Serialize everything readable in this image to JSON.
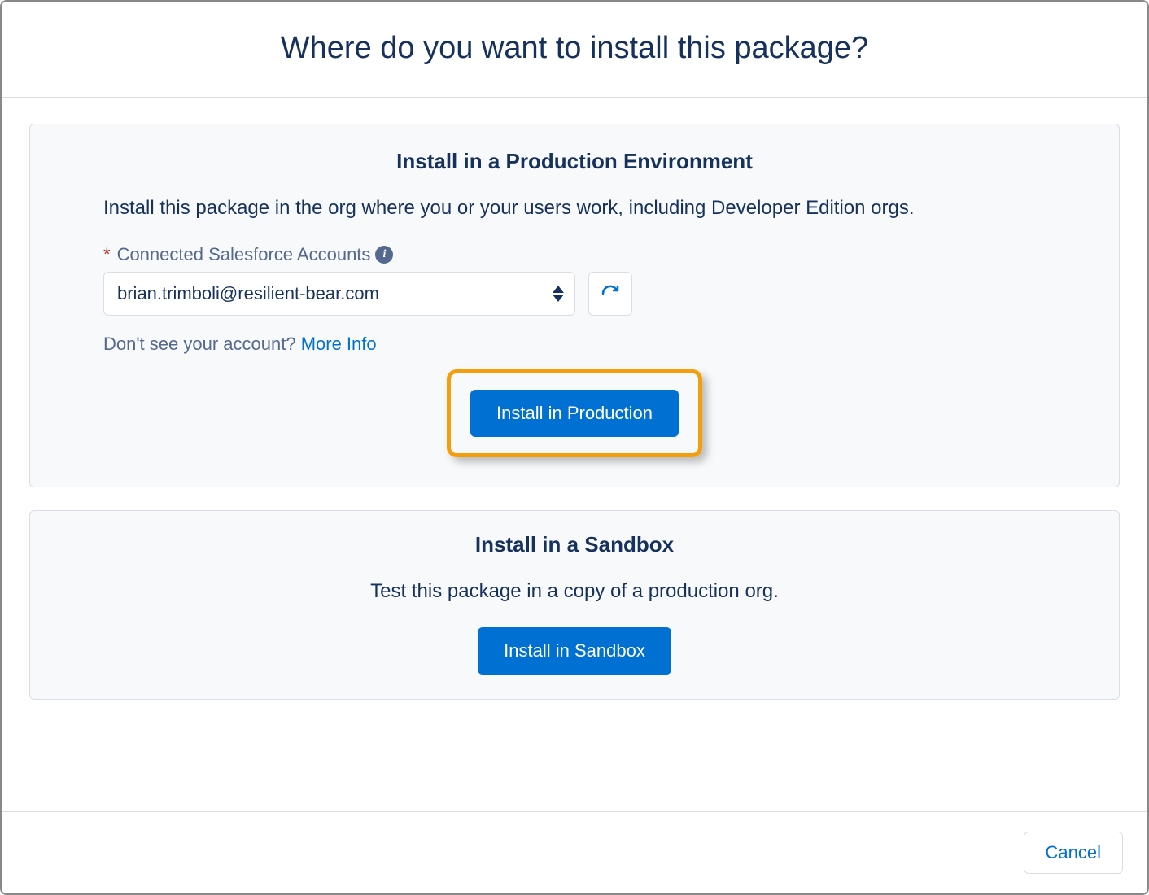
{
  "header": {
    "title": "Where do you want to install this package?"
  },
  "production": {
    "title": "Install in a Production Environment",
    "description": "Install this package in the org where you or your users work, including Developer Edition orgs.",
    "field_label": "Connected Salesforce Accounts",
    "selected_account": "brian.trimboli@resilient-bear.com",
    "help_prefix": "Don't see your account? ",
    "help_link": "More Info",
    "button_label": "Install in Production"
  },
  "sandbox": {
    "title": "Install in a Sandbox",
    "description": "Test this package in a copy of a production org.",
    "button_label": "Install in Sandbox"
  },
  "footer": {
    "cancel_label": "Cancel"
  }
}
